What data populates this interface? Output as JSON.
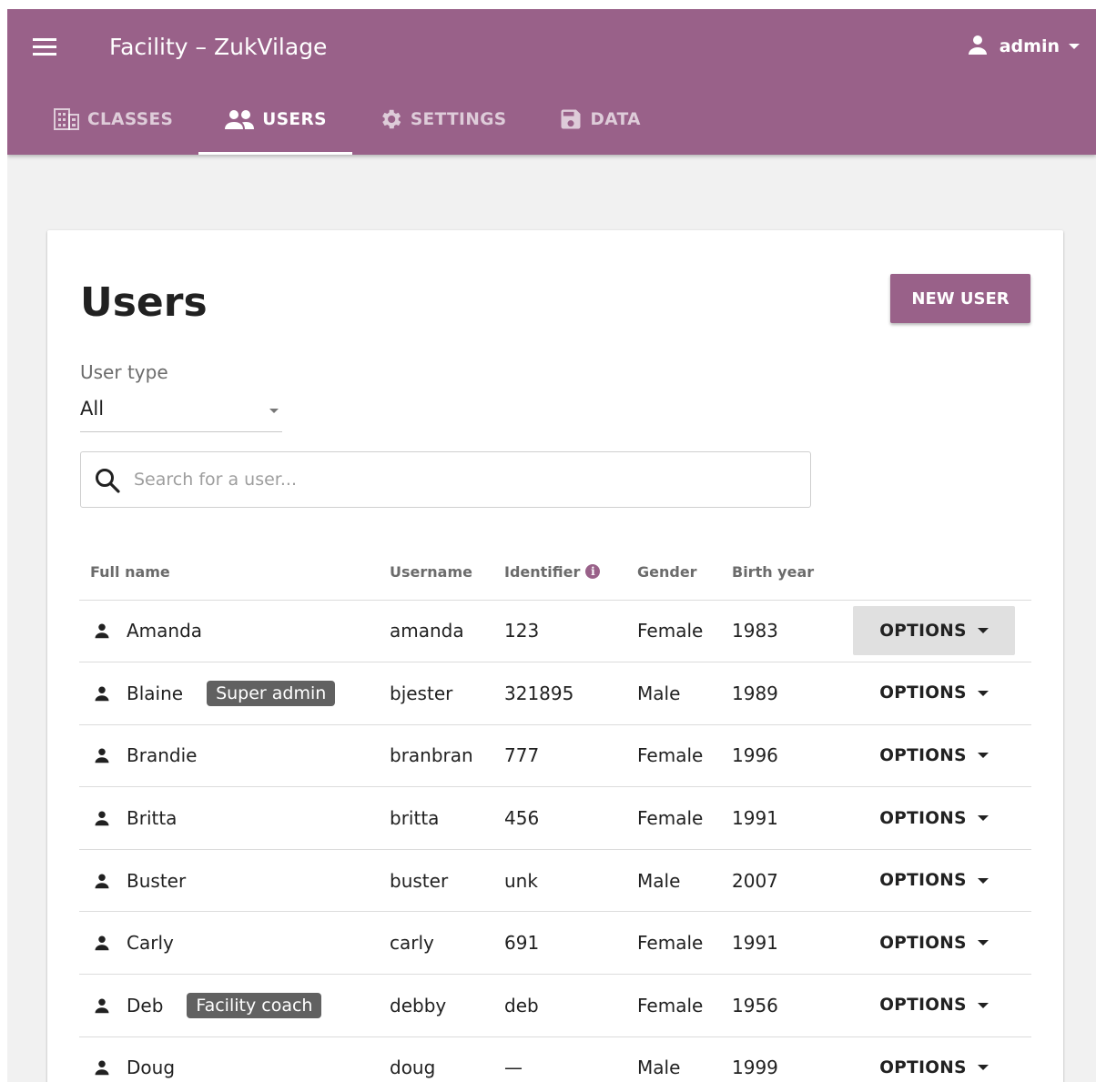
{
  "header": {
    "title": "Facility – ZukVilage",
    "user_name": "admin",
    "tabs": [
      {
        "label": "CLASSES",
        "icon": "building-icon"
      },
      {
        "label": "USERS",
        "icon": "people-icon"
      },
      {
        "label": "SETTINGS",
        "icon": "gear-icon"
      },
      {
        "label": "DATA",
        "icon": "save-icon"
      }
    ],
    "active_tab": "USERS"
  },
  "colors": {
    "brand": "#996189",
    "badge": "#616161"
  },
  "main": {
    "title": "Users",
    "new_user_label": "NEW USER",
    "filter": {
      "label": "User type",
      "value": "All"
    },
    "search": {
      "placeholder": "Search for a user..."
    },
    "table": {
      "headers": [
        "Full name",
        "Username",
        "Identifier",
        "Gender",
        "Birth year"
      ],
      "options_label": "OPTIONS",
      "rows": [
        {
          "name": "Amanda",
          "badge": "",
          "username": "amanda",
          "identifier": "123",
          "gender": "Female",
          "birth_year": "1983"
        },
        {
          "name": "Blaine",
          "badge": "Super admin",
          "username": "bjester",
          "identifier": "321895",
          "gender": "Male",
          "birth_year": "1989"
        },
        {
          "name": "Brandie",
          "badge": "",
          "username": "branbran",
          "identifier": "777",
          "gender": "Female",
          "birth_year": "1996"
        },
        {
          "name": "Britta",
          "badge": "",
          "username": "britta",
          "identifier": "456",
          "gender": "Female",
          "birth_year": "1991"
        },
        {
          "name": "Buster",
          "badge": "",
          "username": "buster",
          "identifier": "unk",
          "gender": "Male",
          "birth_year": "2007"
        },
        {
          "name": "Carly",
          "badge": "",
          "username": "carly",
          "identifier": "691",
          "gender": "Female",
          "birth_year": "1991"
        },
        {
          "name": "Deb",
          "badge": "Facility coach",
          "username": "debby",
          "identifier": "deb",
          "gender": "Female",
          "birth_year": "1956"
        },
        {
          "name": "Doug",
          "badge": "",
          "username": "doug",
          "identifier": "—",
          "gender": "Male",
          "birth_year": "1999"
        }
      ]
    }
  }
}
